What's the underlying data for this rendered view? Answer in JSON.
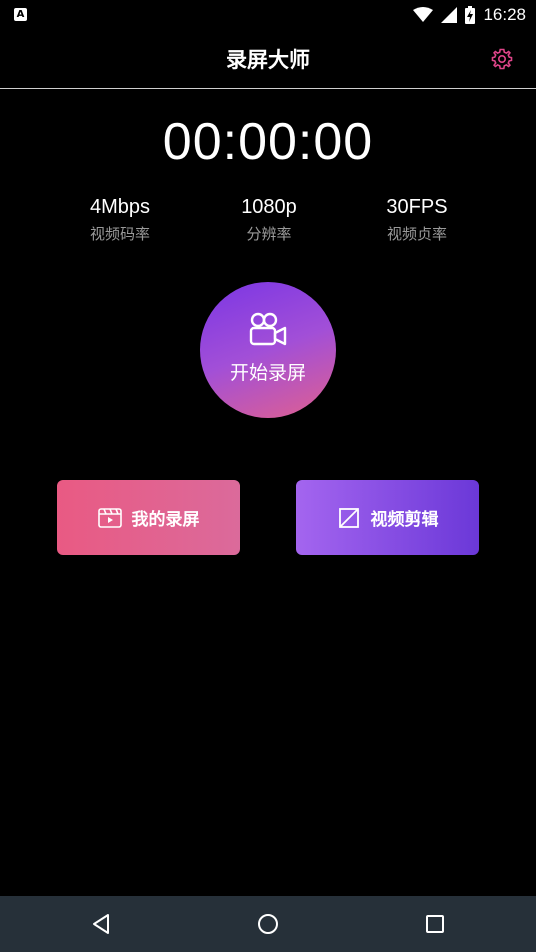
{
  "status_bar": {
    "app_icon_glyph": "A",
    "time": "16:28"
  },
  "header": {
    "title": "录屏大师",
    "settings_icon": "gear-icon",
    "settings_icon_color": "#e0458a"
  },
  "timer": "00:00:00",
  "stats": [
    {
      "value": "4Mbps",
      "label": "视频码率"
    },
    {
      "value": "1080p",
      "label": "分辨率"
    },
    {
      "value": "30FPS",
      "label": "视频贞率"
    }
  ],
  "record_button": {
    "label": "开始录屏",
    "icon": "video-camera-icon"
  },
  "actions": {
    "my_recordings": {
      "label": "我的录屏",
      "icon": "video-file-icon",
      "color": "#e95a83"
    },
    "video_edit": {
      "label": "视频剪辑",
      "icon": "crop-edit-icon",
      "color": "#8a4ee6"
    }
  },
  "nav": {
    "back_icon": "back-triangle-icon",
    "home_icon": "home-circle-icon",
    "recents_icon": "recents-square-icon"
  }
}
